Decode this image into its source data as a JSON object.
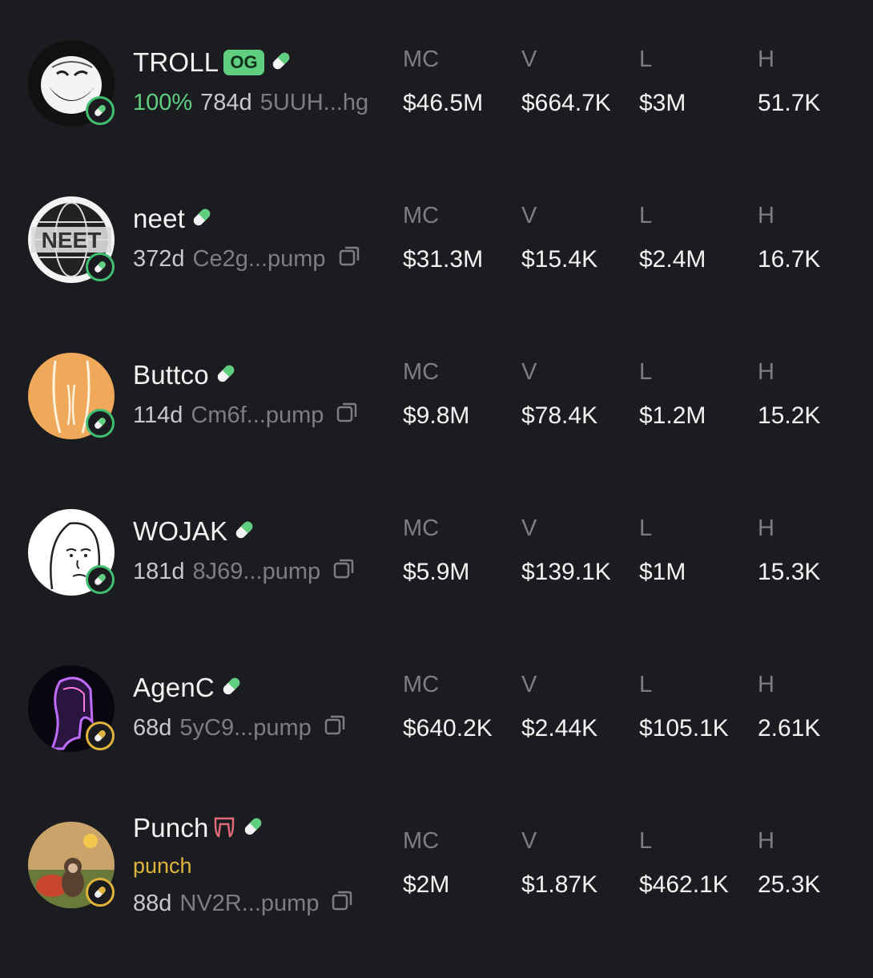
{
  "labels": {
    "mc": "MC",
    "v": "V",
    "l": "L",
    "h": "H"
  },
  "tokens": [
    {
      "name": "TROLL",
      "og": "OG",
      "percent": "100%",
      "age": "784d",
      "address": "5UUH...hg",
      "mc": "$46.5M",
      "v": "$664.7K",
      "l": "$3M",
      "h": "51.7K",
      "avatar": "troll-face-avatar",
      "badge": "green"
    },
    {
      "name": "neet",
      "age": "372d",
      "address": "Ce2g...pump",
      "mc": "$31.3M",
      "v": "$15.4K",
      "l": "$2.4M",
      "h": "16.7K",
      "avatar": "neet-globe-avatar",
      "badge": "green"
    },
    {
      "name": "Buttco",
      "age": "114d",
      "address": "Cm6f...pump",
      "mc": "$9.8M",
      "v": "$78.4K",
      "l": "$1.2M",
      "h": "15.2K",
      "avatar": "buttco-avatar",
      "badge": "green"
    },
    {
      "name": "WOJAK",
      "age": "181d",
      "address": "8J69...pump",
      "mc": "$5.9M",
      "v": "$139.1K",
      "l": "$1M",
      "h": "15.3K",
      "avatar": "wojak-face-avatar",
      "badge": "green"
    },
    {
      "name": "AgenC",
      "age": "68d",
      "address": "5yC9...pump",
      "mc": "$640.2K",
      "v": "$2.44K",
      "l": "$105.1K",
      "h": "2.61K",
      "avatar": "agenc-neon-avatar",
      "badge": "yellow"
    },
    {
      "name": "Punch",
      "tagline": "punch",
      "age": "88d",
      "address": "NV2R...pump",
      "mc": "$2M",
      "v": "$1.87K",
      "l": "$462.1K",
      "h": "25.3K",
      "avatar": "punch-monkey-avatar",
      "badge": "yellow"
    }
  ],
  "colors": {
    "background": "#1b1c20",
    "green": "#5fcf7f",
    "yellow": "#e0b33a",
    "muted": "#7d7e85"
  },
  "icons": [
    "pill-icon",
    "copy-icon",
    "fang-icon",
    "pill-badge-icon"
  ]
}
